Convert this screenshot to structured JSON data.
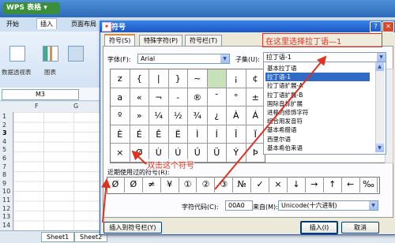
{
  "app": {
    "title": "WPS 表格"
  },
  "menu": {
    "tabs": [
      "开始",
      "插入",
      "页面布局"
    ]
  },
  "ribbon": {
    "labels": [
      "数据透视表",
      "图表"
    ]
  },
  "formula_bar": {
    "cell_ref": "M3"
  },
  "sheet": {
    "columns": [
      "F",
      "G"
    ],
    "rows": [
      "1",
      "2",
      "3",
      "4",
      "5",
      "6",
      "7",
      "8",
      "9",
      "10",
      "11",
      "12",
      "13",
      "14"
    ],
    "tabs": [
      "Sheet1",
      "Sheet2"
    ]
  },
  "dialog": {
    "title": "符号",
    "tabs": [
      "符号(S)",
      "特殊字符(P)",
      "符号栏(T)"
    ],
    "font_label": "字体(F):",
    "font_value": "Arial",
    "subset_label": "子集(U):",
    "subset_value": "拉丁语-1",
    "subset_options": [
      "基本拉丁语",
      "拉丁语-1",
      "拉丁语扩展-A",
      "拉丁语扩展-B",
      "国际音标扩展",
      "进格的修饰字符",
      "组合用发音符",
      "基本希腊语",
      "西里尔语",
      "基本希伯来语"
    ],
    "subset_selected_index": 1,
    "symbols": [
      [
        "z",
        "{",
        "|",
        "}",
        "~",
        "",
        "¡",
        "¢"
      ],
      [
        "a",
        "«",
        "¬",
        "-",
        "®",
        "¯",
        "°",
        "±"
      ],
      [
        "º",
        "»",
        "¼",
        "½",
        "¾",
        "¿",
        "À",
        "Á"
      ],
      [
        "È",
        "É",
        "Ê",
        "Ë",
        "Ì",
        "Í",
        "Î",
        "Ï"
      ],
      [
        "×",
        "Ø",
        "Ù",
        "Ú",
        "Û",
        "Ü",
        "Ý",
        "Þ"
      ]
    ],
    "symbols_right_col": [
      "£",
      "²",
      "Â",
      "Ð",
      "ß"
    ],
    "recent_label": "近期使用过的符号(R):",
    "recent_symbols": [
      "Ø",
      "Ø",
      "≠",
      "¥",
      "①",
      "②",
      "③",
      "№",
      "✓",
      "×",
      "↓",
      "→",
      "↑",
      "←",
      "‰"
    ],
    "char_code_label": "字符代码(C):",
    "char_code_value": "00A0",
    "from_label": "来自(M):",
    "from_value": "Unicode(十六进制)",
    "insert_toolbar_button": "插入到符号栏(Y)",
    "insert_button": "插入(I)",
    "cancel_button": "取消"
  },
  "annotations": {
    "subset_hint": "在这里选择拉丁语—1",
    "symbol_hint": "双击这个符号"
  },
  "colors": {
    "title_bar": "#1a56c8",
    "annotation": "#e0301e",
    "highlight_cell": "#c7e1b8"
  }
}
